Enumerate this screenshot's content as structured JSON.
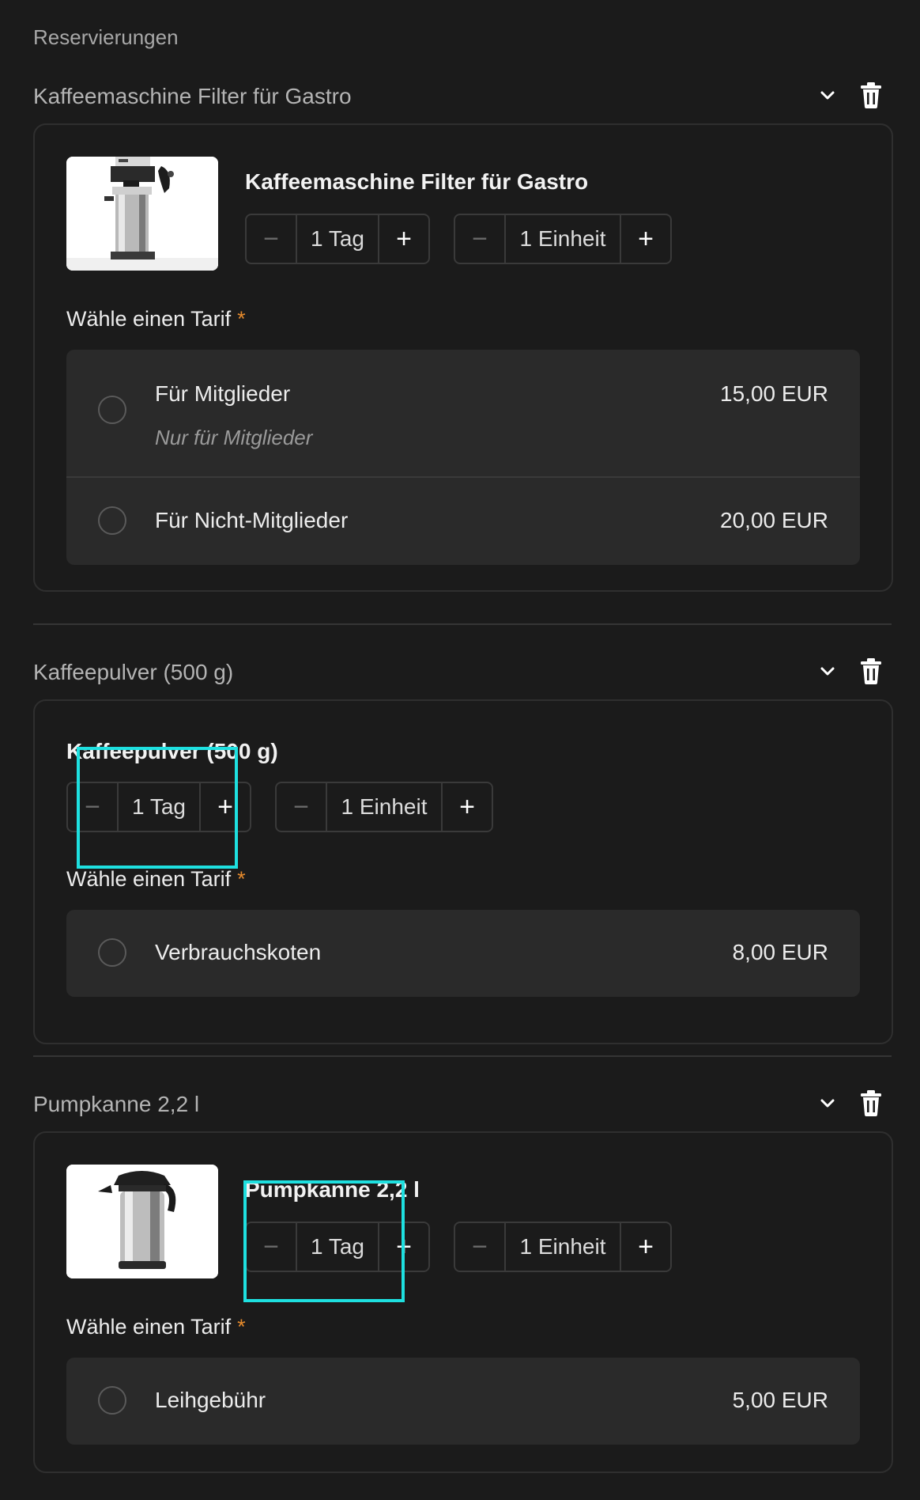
{
  "page": {
    "label": "Reservierungen"
  },
  "icons": {
    "chevron": "chevron-down-icon",
    "trash": "trash-icon",
    "minus": "minus-icon",
    "plus": "plus-icon",
    "radio": "radio-unchecked-icon"
  },
  "colors": {
    "required": "#e58a2c",
    "highlight": "#1ee0e0",
    "background": "#1b1b1b",
    "option_bg": "#2a2a2a"
  },
  "items": [
    {
      "header": "Kaffeemaschine Filter für Gastro",
      "product_name": "Kaffeemaschine Filter für Gastro",
      "duration": {
        "minus": "−",
        "value": "1 Tag",
        "plus": "+"
      },
      "quantity": {
        "minus": "−",
        "value": "1 Einheit",
        "plus": "+"
      },
      "tarif_label": "Wähle einen Tarif",
      "required_mark": "*",
      "options": [
        {
          "name": "Für Mitglieder",
          "sub": "Nur für Mitglieder",
          "price": "15,00 EUR"
        },
        {
          "name": "Für Nicht-Mitglieder",
          "price": "20,00 EUR"
        }
      ]
    },
    {
      "header": "Kaffeepulver (500 g)",
      "product_name": "Kaffeepulver (500 g)",
      "duration": {
        "minus": "−",
        "value": "1 Tag",
        "plus": "+"
      },
      "quantity": {
        "minus": "−",
        "value": "1 Einheit",
        "plus": "+"
      },
      "tarif_label": "Wähle einen Tarif",
      "required_mark": "*",
      "options": [
        {
          "name": "Verbrauchskoten",
          "price": "8,00 EUR"
        }
      ]
    },
    {
      "header": "Pumpkanne 2,2 l",
      "product_name": "Pumpkanne 2,2 l",
      "duration": {
        "minus": "−",
        "value": "1 Tag",
        "plus": "+"
      },
      "quantity": {
        "minus": "−",
        "value": "1 Einheit",
        "plus": "+"
      },
      "tarif_label": "Wähle einen Tarif",
      "required_mark": "*",
      "options": [
        {
          "name": "Leihgebühr",
          "price": "5,00 EUR"
        }
      ]
    }
  ]
}
